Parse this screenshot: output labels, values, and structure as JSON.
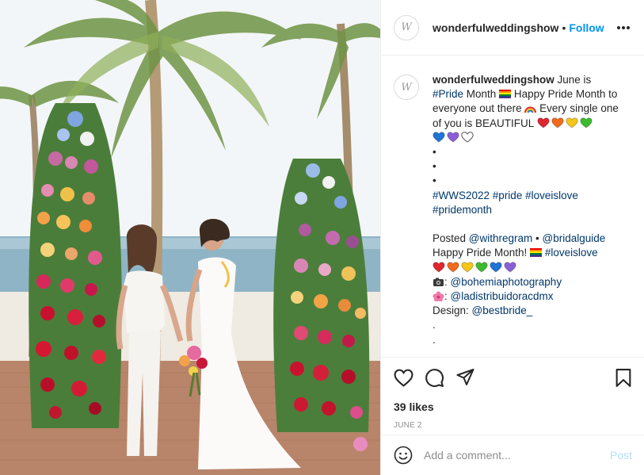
{
  "post": {
    "username": "wonderfulweddingshow",
    "follow_label": "Follow",
    "avatar_monogram": "W",
    "caption": {
      "username": "wonderfulweddingshow",
      "part1": " June is ",
      "tag_pride": "#Pride",
      "part2": " Month ",
      "part3": " Happy Pride Month to everyone out there ",
      "part4": " Every single one of you is BEAUTIFUL ",
      "dot": "•",
      "hashtags": [
        "#WWS2022",
        "#pride",
        "#loveislove",
        "#pridemonth"
      ],
      "posted_label": "Posted ",
      "mention_regram": "@withregram",
      "sep": " • ",
      "mention_bridal": "@bridalguide",
      "happy_pride": "Happy Pride Month! ",
      "tag_loveislove": "#loveislove",
      "mention_photo": "@bohemiaphotography",
      "mention_flowers": "@ladistribuidoracdmx",
      "design_label": "Design: ",
      "mention_design": "@bestbride_",
      "period": "."
    },
    "likes": "39 likes",
    "date": "JUNE 2",
    "comment_placeholder": "Add a comment...",
    "post_label": "Post",
    "hearts_row1": [
      "#e0262f",
      "#f26a1b",
      "#f5c71a",
      "#3dbb2e"
    ],
    "hearts_row2": [
      "#1f74d6",
      "#8a5fd6",
      "#ffffff"
    ],
    "hearts_row3": [
      "#e0262f",
      "#f26a1b",
      "#f5c71a",
      "#3dbb2e",
      "#1f74d6",
      "#8a5fd6"
    ],
    "icons": {
      "like": "heart-outline-icon",
      "comment": "comment-bubble-icon",
      "share": "paper-plane-icon",
      "save": "bookmark-icon",
      "emoji": "smiley-icon",
      "more": "more-options-icon"
    },
    "accent": "#0095f6",
    "link_color": "#00376b"
  }
}
